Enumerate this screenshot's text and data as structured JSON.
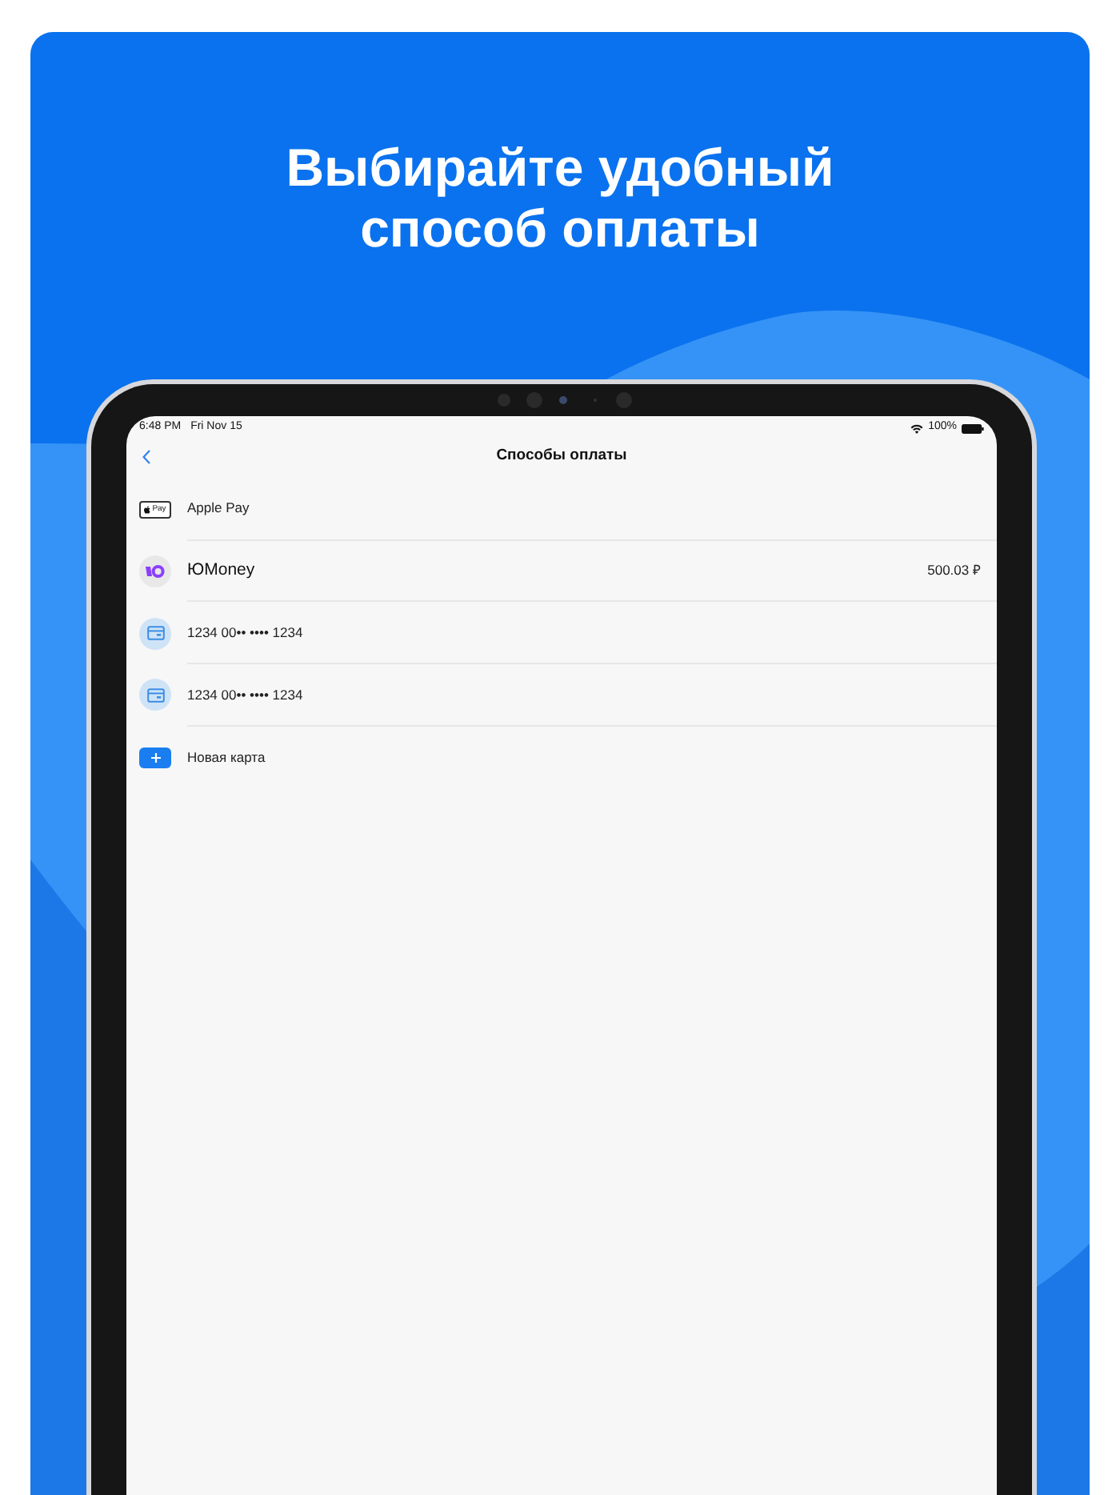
{
  "headline_lines": [
    "Выбирайте удобный",
    "способ оплаты"
  ],
  "status_bar": {
    "time": "6:48 PM",
    "date": "Fri Nov 15",
    "battery": "100%"
  },
  "nav": {
    "title": "Способы оплаты"
  },
  "methods": [
    {
      "kind": "applepay",
      "badge": "Pay",
      "label": "Apple Pay"
    },
    {
      "kind": "wallet",
      "label": "ЮMoney",
      "balance": "500.03 ₽"
    },
    {
      "kind": "card",
      "label": "1234 00•• •••• 1234"
    },
    {
      "kind": "card",
      "label": "1234 00•• •••• 1234"
    },
    {
      "kind": "add",
      "label": "Новая карта"
    }
  ]
}
